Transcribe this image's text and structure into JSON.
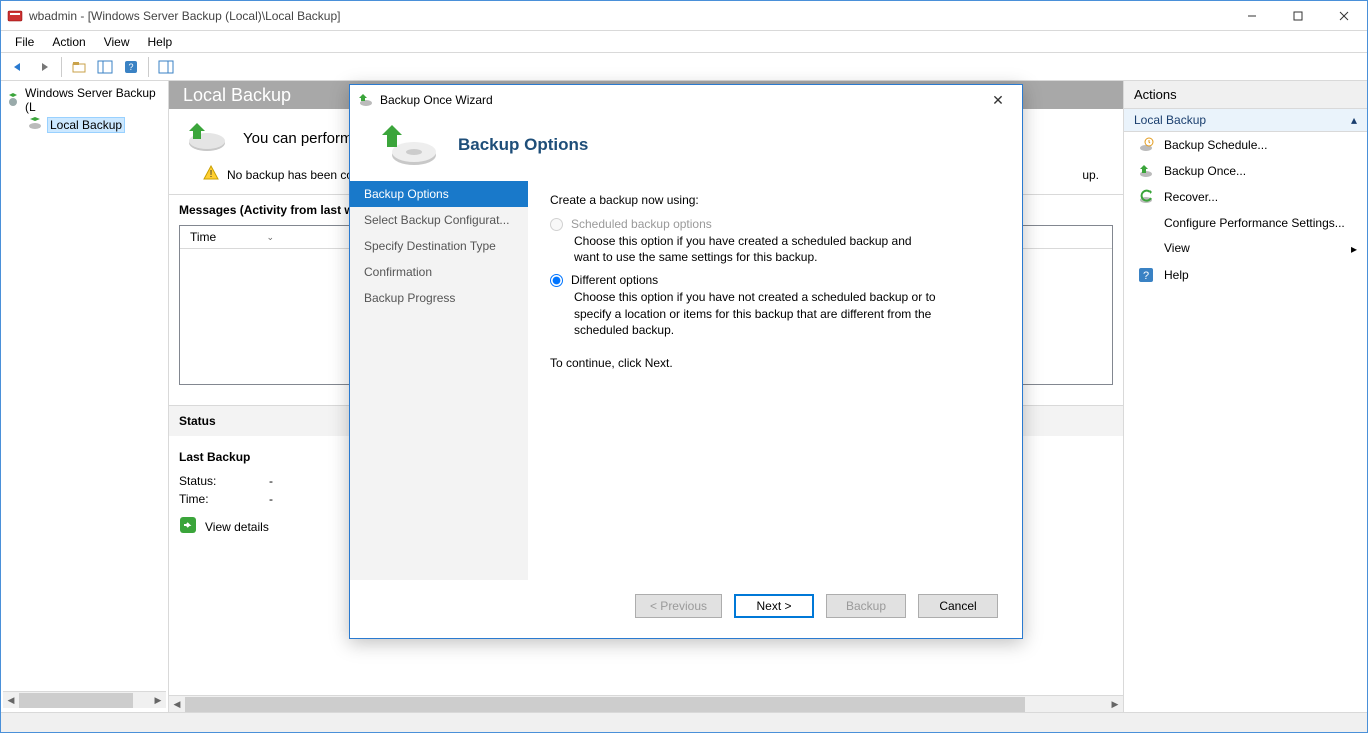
{
  "title": "wbadmin - [Windows Server Backup (Local)\\Local Backup]",
  "menubar": [
    "File",
    "Action",
    "View",
    "Help"
  ],
  "tree": {
    "root": "Windows Server Backup (L",
    "child": "Local Backup"
  },
  "center": {
    "header": "Local Backup",
    "subhead": "You can perform",
    "warn": "No backup has been co",
    "warn_tail": "up.",
    "messages_title": "Messages (Activity from last w",
    "columns": {
      "time": "Time"
    },
    "status_title": "Status",
    "last_backup_title": "Last Backup",
    "status_label": "Status:",
    "status_value": "-",
    "time_label": "Time:",
    "time_value": "-",
    "view_details": "View details"
  },
  "actions": {
    "title": "Actions",
    "group": "Local Backup",
    "items": [
      {
        "label": "Backup Schedule...",
        "icon": "schedule"
      },
      {
        "label": "Backup Once...",
        "icon": "once"
      },
      {
        "label": "Recover...",
        "icon": "recover"
      },
      {
        "label": "Configure Performance Settings...",
        "icon": ""
      },
      {
        "label": "View",
        "icon": "",
        "submenu": true
      },
      {
        "label": "Help",
        "icon": "help"
      }
    ]
  },
  "dialog": {
    "title": "Backup Once Wizard",
    "page_title": "Backup Options",
    "steps": [
      "Backup Options",
      "Select Backup Configurat...",
      "Specify Destination Type",
      "Confirmation",
      "Backup Progress"
    ],
    "active_step": 0,
    "prompt": "Create a backup now using:",
    "opt1_label": "Scheduled backup options",
    "opt1_desc": "Choose this option if you have created a scheduled backup and want to use the same settings for this backup.",
    "opt2_label": "Different options",
    "opt2_desc": "Choose this option if you have not created a scheduled backup or to specify a location or items for this backup that are different from the scheduled backup.",
    "continue": "To continue, click Next.",
    "buttons": {
      "prev": "< Previous",
      "next": "Next >",
      "backup": "Backup",
      "cancel": "Cancel"
    }
  }
}
